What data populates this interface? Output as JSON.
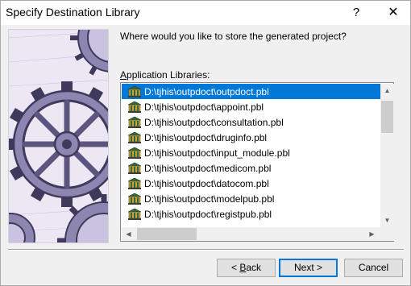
{
  "window": {
    "title": "Specify Destination Library",
    "help_glyph": "?",
    "close_glyph": "✕"
  },
  "prompt": "Where would you like to store the generated project?",
  "list": {
    "label_mnemonic": "A",
    "label_rest": "pplication Libraries:",
    "selected_index": 0,
    "items": [
      {
        "text": "D:\\tjhis\\outpdoct\\outpdoct.pbl",
        "icon": "library-icon"
      },
      {
        "text": "D:\\tjhis\\outpdoct\\appoint.pbl",
        "icon": "library-icon"
      },
      {
        "text": "D:\\tjhis\\outpdoct\\consultation.pbl",
        "icon": "library-icon"
      },
      {
        "text": "D:\\tjhis\\outpdoct\\druginfo.pbl",
        "icon": "library-icon"
      },
      {
        "text": "D:\\tjhis\\outpdoct\\input_module.pbl",
        "icon": "library-icon"
      },
      {
        "text": "D:\\tjhis\\outpdoct\\medicom.pbl",
        "icon": "library-icon"
      },
      {
        "text": "D:\\tjhis\\outpdoct\\datocom.pbl",
        "icon": "library-icon"
      },
      {
        "text": "D:\\tjhis\\outpdoct\\modelpub.pbl",
        "icon": "library-icon"
      },
      {
        "text": "D:\\tjhis\\outpdoct\\registpub.pbl",
        "icon": "library-icon"
      }
    ]
  },
  "scrollbars": {
    "up": "▲",
    "down": "▼",
    "left": "◀",
    "right": "▶"
  },
  "buttons": {
    "back_prefix": "< ",
    "back_mnemonic": "B",
    "back_rest": "ack",
    "next": "Next >",
    "cancel": "Cancel"
  },
  "colors": {
    "selection": "#0078d7",
    "art_bg": "#ece7f3",
    "gear_dark": "#3f3a5c",
    "gear_mid": "#8c86b0",
    "gear_light": "#c9c3df"
  }
}
